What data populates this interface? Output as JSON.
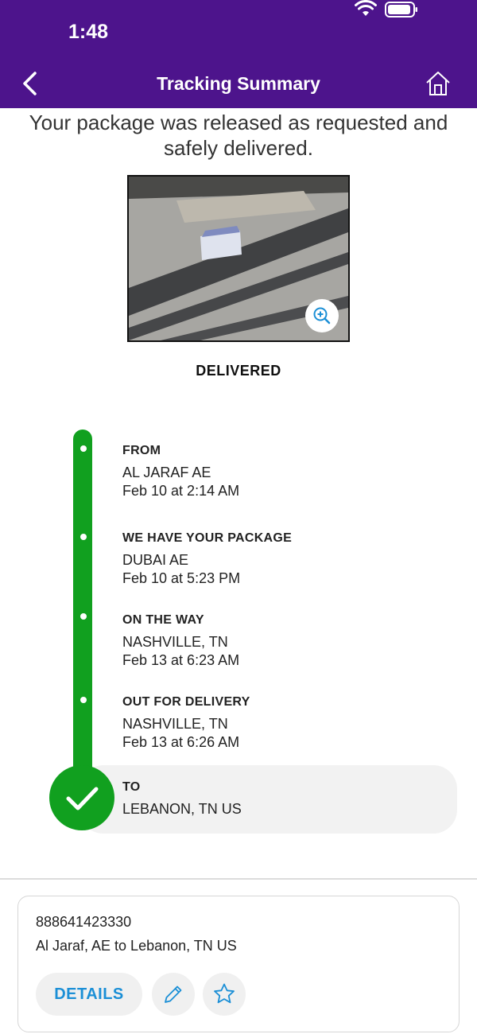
{
  "status_bar": {
    "time": "1:48"
  },
  "nav": {
    "title": "Tracking Summary"
  },
  "summary": {
    "headline": "Your package was released as requested and safely delivered.",
    "status": "DELIVERED"
  },
  "timeline": [
    {
      "title": "FROM",
      "lines": [
        "AL JARAF AE",
        "Feb 10 at 2:14 AM"
      ]
    },
    {
      "title": "WE HAVE YOUR PACKAGE",
      "lines": [
        "DUBAI AE",
        "Feb 10 at 5:23 PM"
      ]
    },
    {
      "title": "ON THE WAY",
      "lines": [
        "NASHVILLE, TN",
        "Feb 13 at 6:23 AM"
      ]
    },
    {
      "title": "OUT FOR DELIVERY",
      "lines": [
        "NASHVILLE, TN",
        "Feb 13 at 6:26 AM"
      ]
    },
    {
      "title": "TO",
      "lines": [
        "LEBANON, TN  US"
      ]
    }
  ],
  "card": {
    "tracking_number": "888641423330",
    "route": "Al Jaraf, AE to Lebanon, TN US",
    "details_label": "DETAILS"
  },
  "colors": {
    "brand_purple": "#4d148c",
    "progress_green": "#11a01f",
    "link_blue": "#1b8fd6"
  },
  "icons": {
    "back": "chevron-left-icon",
    "home": "home-icon",
    "zoom": "zoom-in-icon",
    "check": "checkmark-icon",
    "edit": "pencil-icon",
    "favorite": "star-icon"
  }
}
